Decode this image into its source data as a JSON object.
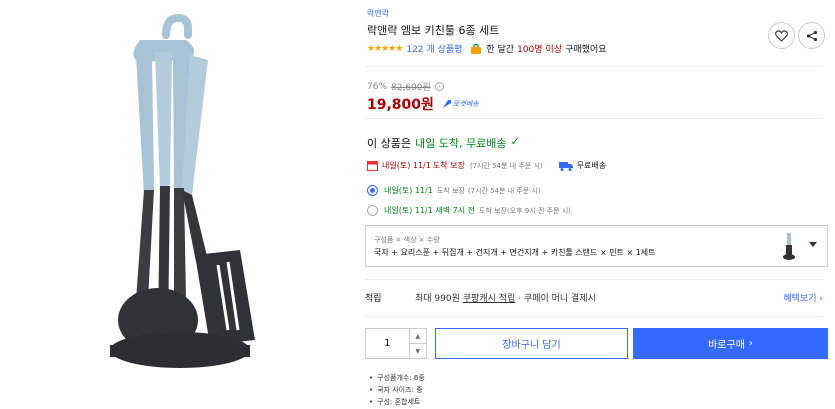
{
  "product": {
    "brand": "락앤락",
    "title": "락앤락 엠보 키친툴 6종 세트",
    "rating_stars": "★★★★★",
    "review_count": "122 개 상품평",
    "purchase_prefix": "한 달간",
    "purchase_highlight": "100명",
    "purchase_count": "이상",
    "purchase_suffix": "구매했어요"
  },
  "price": {
    "discount": "76%",
    "original": "82,600원",
    "current": "19,800원",
    "badge": "로켓배송"
  },
  "arrival": {
    "prefix": "이 상품은",
    "highlight": "내일 도착, 무료배송",
    "check": "✓"
  },
  "delivery": {
    "date": "내일(토) 11/1",
    "guarantee": "도착 보장",
    "note": "(7시간 54분 내 주문 시)",
    "free": "무료배송"
  },
  "options": [
    {
      "selected": true,
      "date": "내일(토) 11/1",
      "guarantee": "도착 보장",
      "note": "(7시간 54분 내 주문 시)"
    },
    {
      "selected": false,
      "date": "내일(토) 11/1 새벽 7시 전",
      "guarantee": "도착 보장",
      "note": "(오후 9시 전 주문 시)"
    }
  ],
  "variant": {
    "label": "구성품 × 색상 × 수량",
    "value": "국자 + 요리스푼 + 뒤집개 + 건지개 + 면건지개 + 키친툴 스탠드 × 민트 × 1세트"
  },
  "points": {
    "title": "적립",
    "prefix": "최대 990원",
    "link_text": "쿠팡캐시 적립",
    "suffix": "· 쿠페이 머니 결제시",
    "more": "혜택보기 ›"
  },
  "purchase": {
    "quantity": "1",
    "cart_label": "장바구니 담기",
    "buy_label": "바로구매",
    "buy_arrow": "›"
  },
  "specs": [
    "구성품개수: 6종",
    "국자 사이즈: 중",
    "구성: 혼합세트"
  ],
  "colors": {
    "accent": "#346aff",
    "price": "#ae0000",
    "green": "#00891a",
    "handle": "#a9c3d6",
    "body": "#3a3d42"
  },
  "icons": [
    "heart-icon",
    "share-icon",
    "info-icon",
    "rocket-icon",
    "calendar-icon",
    "truck-icon",
    "bag-icon"
  ]
}
